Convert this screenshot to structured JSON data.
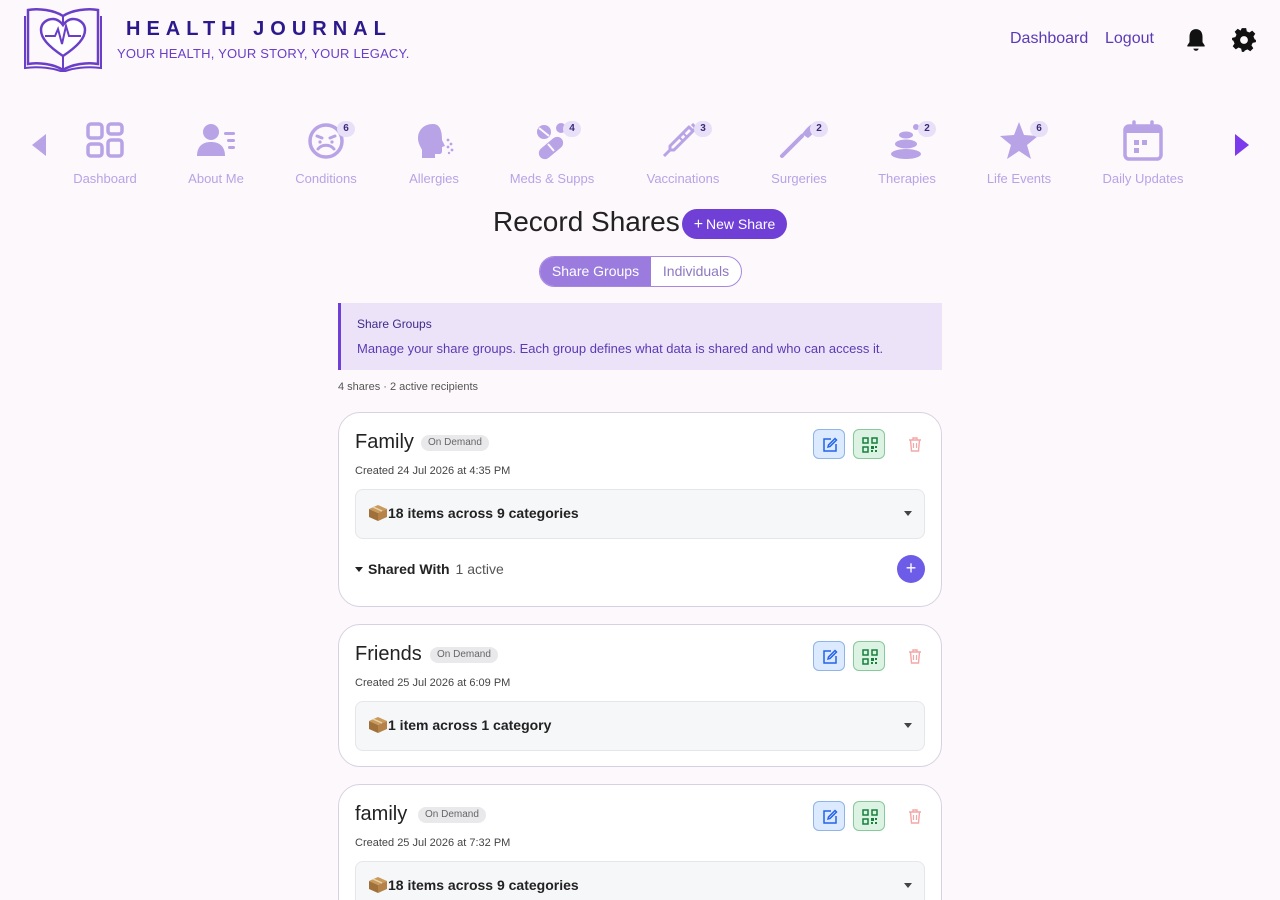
{
  "header": {
    "title": "HEALTH JOURNAL",
    "tagline": "YOUR HEALTH, YOUR STORY, YOUR LEGACY.",
    "links": {
      "dashboard": "Dashboard",
      "logout": "Logout"
    },
    "icons": [
      "bell-icon",
      "gear-icon"
    ]
  },
  "nav": [
    {
      "label": "Dashboard",
      "icon": "dashboard-icon",
      "badge": ""
    },
    {
      "label": "About Me",
      "icon": "person-icon",
      "badge": ""
    },
    {
      "label": "Conditions",
      "icon": "sick-face-icon",
      "badge": "6"
    },
    {
      "label": "Allergies",
      "icon": "sneeze-icon",
      "badge": ""
    },
    {
      "label": "Meds & Supps",
      "icon": "pills-icon",
      "badge": "4"
    },
    {
      "label": "Vaccinations",
      "icon": "syringe-icon",
      "badge": "3"
    },
    {
      "label": "Surgeries",
      "icon": "scalpel-icon",
      "badge": "2"
    },
    {
      "label": "Therapies",
      "icon": "stones-icon",
      "badge": "2"
    },
    {
      "label": "Life Events",
      "icon": "star-icon",
      "badge": "6"
    },
    {
      "label": "Daily Updates",
      "icon": "calendar-icon",
      "badge": ""
    }
  ],
  "main": {
    "title": "Record Shares",
    "new_share_label": "New Share",
    "tabs": {
      "active": "Share Groups",
      "inactive": "Individuals"
    },
    "info": {
      "title": "Share Groups",
      "text": "Manage your share groups. Each group defines what data is shared and who can access it."
    },
    "summary": "4 shares · 2 active recipients"
  },
  "cards": [
    {
      "name": "Family",
      "badge": "On Demand",
      "created": "Created 24 Jul 2026 at 4:35 PM",
      "items": "18 items across 9 categories",
      "shared_label": "Shared With",
      "shared_count": "1 active"
    },
    {
      "name": "Friends",
      "badge": "On Demand",
      "created": "Created 25 Jul 2026 at 6:09 PM",
      "items": "1 item across 1 category"
    },
    {
      "name": "family",
      "badge": "On Demand",
      "created": "Created 25 Jul 2026 at 7:32 PM",
      "items": "18 items across 9 categories"
    }
  ],
  "colors": {
    "accent": "#6f3fd6",
    "nav_icon": "#b7a3e6",
    "background": "#fdf8fc"
  }
}
